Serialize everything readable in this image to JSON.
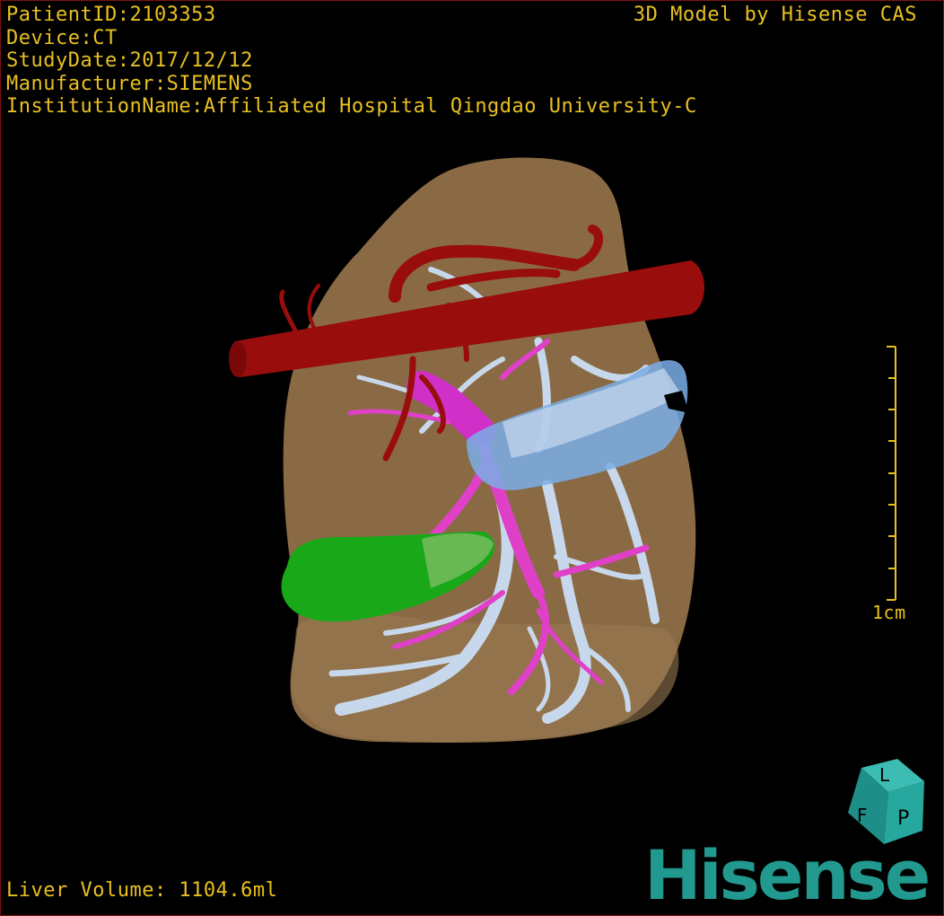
{
  "header_info": {
    "patient_id": "PatientID:2103353",
    "device": "Device:CT",
    "study_date": "StudyDate:2017/12/12",
    "manufacturer": "Manufacturer:SIEMENS",
    "institution": "InstitutionName:Affiliated Hospital Qingdao University-C"
  },
  "model_credit": "3D Model by Hisense CAS",
  "footer": {
    "liver_volume": "Liver Volume: 1104.6ml"
  },
  "scale_bar": {
    "label": "1cm",
    "ticks": 9
  },
  "orientation_cube": {
    "face_labels": [
      "F",
      "L",
      "P"
    ]
  },
  "logo": {
    "text": "Hisense"
  },
  "colors": {
    "overlay_text": "#e8c020",
    "liver": "#8a6a45",
    "artery": "#990d0d",
    "portal_vein": "#e040c8",
    "hepatic_vein": "#c8d8ec",
    "ivc": "#7aaee8",
    "gallbladder": "#18a818",
    "logo": "#21998f",
    "border": "#7a1212"
  },
  "structures": [
    "liver",
    "hepatic-artery",
    "portal-vein",
    "hepatic-vein",
    "inferior-vena-cava",
    "gallbladder"
  ]
}
